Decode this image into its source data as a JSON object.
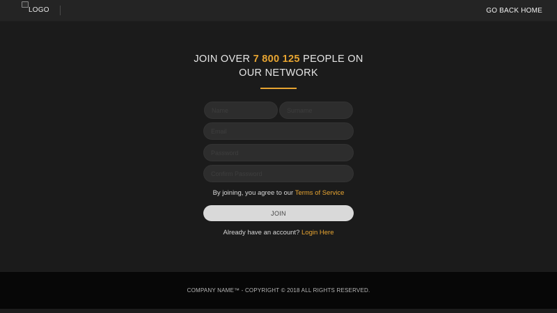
{
  "header": {
    "logo_text": "LOGO",
    "back_home_label": "GO BACK HOME"
  },
  "hero": {
    "title_prefix": "JOIN OVER ",
    "member_count": "7 800 125",
    "title_suffix": " PEOPLE ON OUR NETWORK"
  },
  "form": {
    "name_placeholder": "Name",
    "surname_placeholder": "Surname",
    "email_placeholder": "Email",
    "password_placeholder": "Password",
    "confirm_placeholder": "Confirm Password",
    "agree_text": "By joining, you agree to our ",
    "terms_link": "Terms of Service",
    "join_label": "JOIN",
    "login_text": "Already have an account? ",
    "login_link": "Login Here"
  },
  "footer": {
    "copyright": "COMPANY NAME™ - COPYRIGHT © 2018 ALL RIGHTS RESERVED."
  },
  "colors": {
    "accent": "#e8a531",
    "background": "#1b1b1b",
    "footer": "#070707"
  }
}
